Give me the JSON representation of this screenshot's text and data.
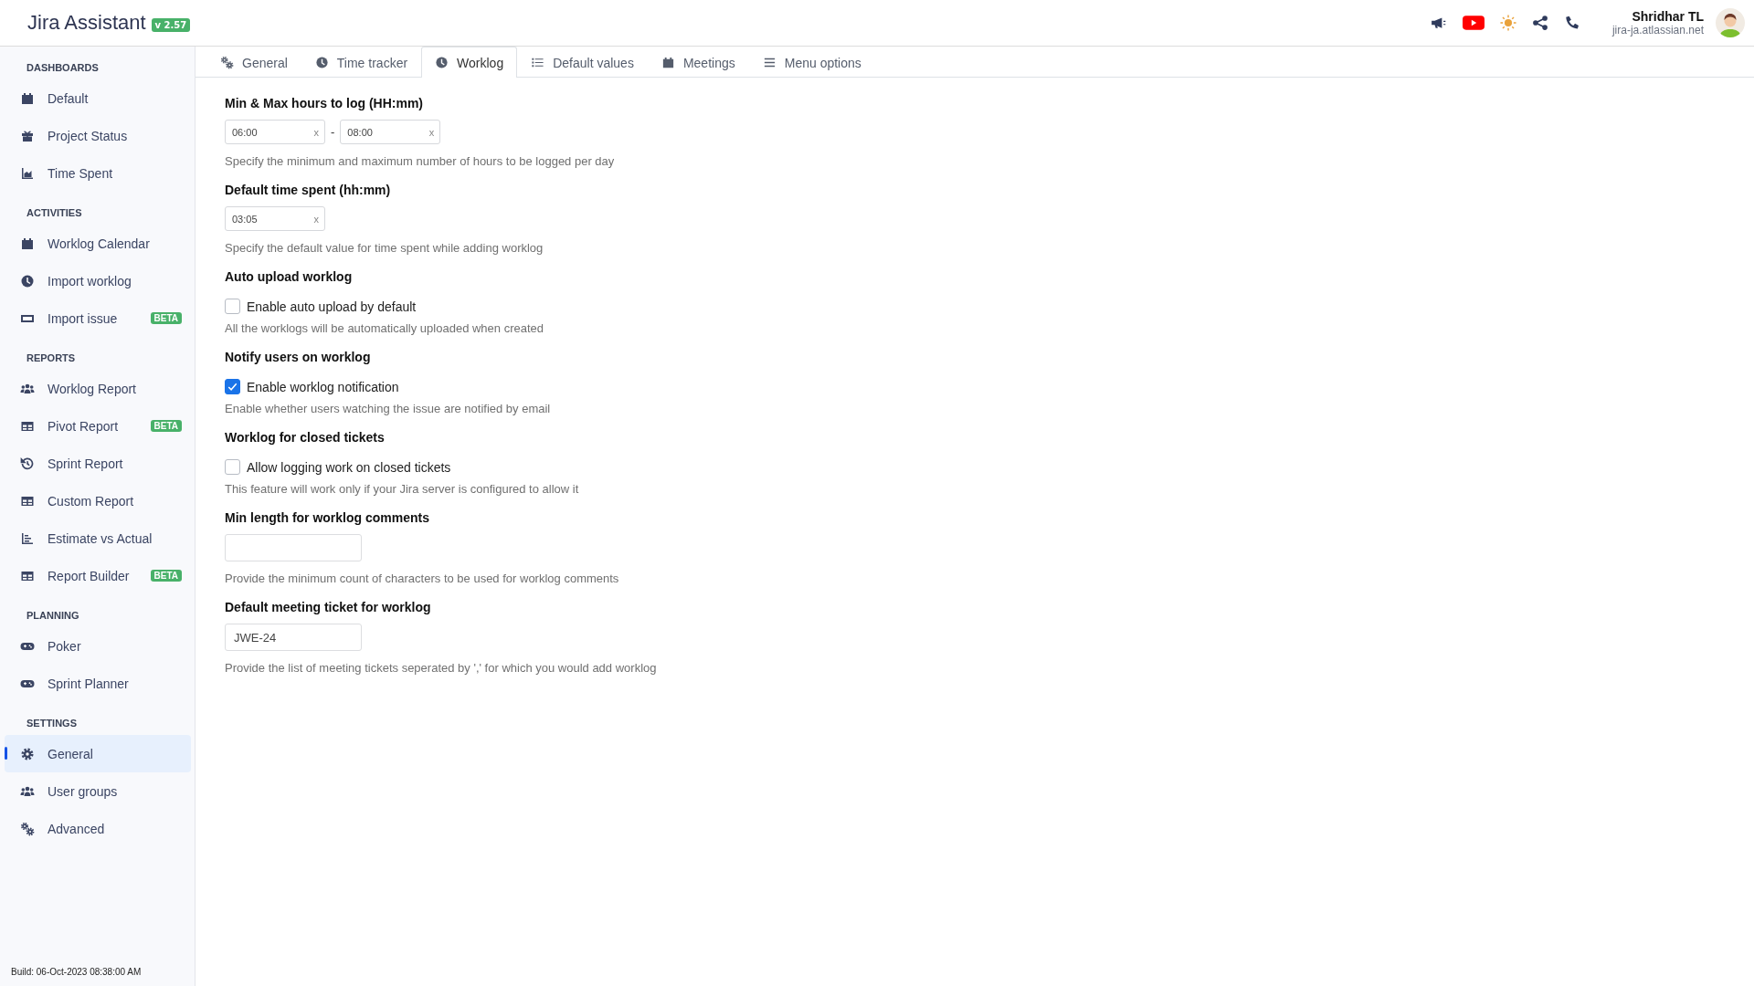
{
  "header": {
    "title": "Jira Assistant",
    "version": "v 2.57",
    "user": {
      "name": "Shridhar TL",
      "site": "jira-ja.atlassian.net"
    }
  },
  "sidebar": {
    "sections": [
      {
        "heading": "DASHBOARDS",
        "items": [
          {
            "label": "Default",
            "selected": false
          },
          {
            "label": "Project Status",
            "selected": false
          },
          {
            "label": "Time Spent",
            "selected": false
          }
        ]
      },
      {
        "heading": "ACTIVITIES",
        "items": [
          {
            "label": "Worklog Calendar",
            "selected": false
          },
          {
            "label": "Import worklog",
            "selected": false
          },
          {
            "label": "Import issue",
            "badge": "BETA",
            "selected": false
          }
        ]
      },
      {
        "heading": "REPORTS",
        "items": [
          {
            "label": "Worklog Report",
            "selected": false
          },
          {
            "label": "Pivot Report",
            "badge": "BETA",
            "selected": false
          },
          {
            "label": "Sprint Report",
            "selected": false
          },
          {
            "label": "Custom Report",
            "selected": false
          },
          {
            "label": "Estimate vs Actual",
            "selected": false
          },
          {
            "label": "Report Builder",
            "badge": "BETA",
            "selected": false
          }
        ]
      },
      {
        "heading": "PLANNING",
        "items": [
          {
            "label": "Poker",
            "selected": false
          },
          {
            "label": "Sprint Planner",
            "selected": false
          }
        ]
      },
      {
        "heading": "SETTINGS",
        "items": [
          {
            "label": "General",
            "selected": true
          },
          {
            "label": "User groups",
            "selected": false
          },
          {
            "label": "Advanced",
            "selected": false
          }
        ]
      }
    ],
    "build": "Build: 06-Oct-2023 08:38:00 AM"
  },
  "tabs": [
    {
      "label": "General",
      "selected": false
    },
    {
      "label": "Time tracker",
      "selected": false
    },
    {
      "label": "Worklog",
      "selected": true
    },
    {
      "label": "Default values",
      "selected": false
    },
    {
      "label": "Meetings",
      "selected": false
    },
    {
      "label": "Menu options",
      "selected": false
    }
  ],
  "settings": [
    {
      "kind": "range",
      "title": "Min & Max hours to log (HH:mm)",
      "from": {
        "value": "06:00",
        "clear": "x"
      },
      "separator": "-",
      "to": {
        "value": "08:00",
        "clear": "x"
      },
      "help": "Specify the minimum and maximum number of hours to be logged per day"
    },
    {
      "kind": "time",
      "title": "Default time spent (hh:mm)",
      "field": {
        "value": "03:05",
        "clear": "x"
      },
      "help": "Specify the default value for time spent while adding worklog"
    },
    {
      "kind": "checkbox",
      "title": "Auto upload worklog",
      "label": "Enable auto upload by default",
      "checked": false,
      "help": "All the worklogs will be automatically uploaded when created"
    },
    {
      "kind": "checkbox",
      "title": "Notify users on worklog",
      "label": "Enable worklog notification",
      "checked": true,
      "help": "Enable whether users watching the issue are notified by email"
    },
    {
      "kind": "checkbox",
      "title": "Worklog for closed tickets",
      "label": "Allow logging work on closed tickets",
      "checked": false,
      "help": "This feature will work only if your Jira server is configured to allow it"
    },
    {
      "kind": "text",
      "title": "Min length for worklog comments",
      "help": "Provide the minimum count of characters to be used for worklog comments"
    },
    {
      "kind": "text",
      "title": "Default meeting ticket for worklog",
      "value": "JWE-24",
      "help": "Provide the list of meeting tickets seperated by ',' for which you would add worklog"
    }
  ]
}
